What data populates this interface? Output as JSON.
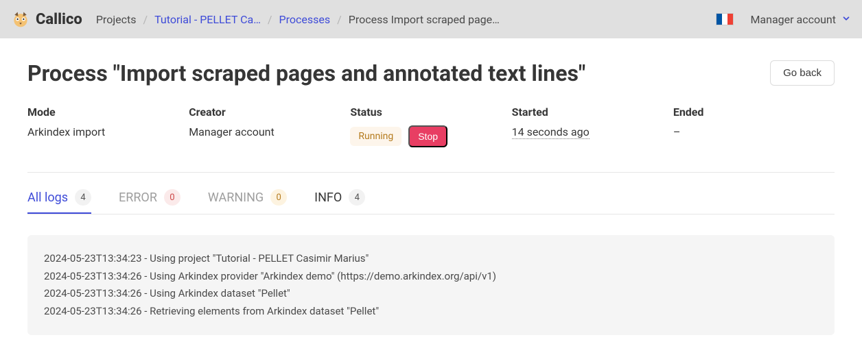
{
  "brand": "Callico",
  "breadcrumbs": {
    "projects": "Projects",
    "project": "Tutorial - PELLET Ca…",
    "processes": "Processes",
    "current": "Process Import scraped page…"
  },
  "nav": {
    "account": "Manager account"
  },
  "page": {
    "title": "Process \"Import scraped pages and annotated text lines\"",
    "go_back": "Go back"
  },
  "meta": {
    "mode_label": "Mode",
    "mode": "Arkindex import",
    "creator_label": "Creator",
    "creator": "Manager account",
    "status_label": "Status",
    "status_running": "Running",
    "status_stop": "Stop",
    "started_label": "Started",
    "started": "14 seconds ago",
    "ended_label": "Ended",
    "ended": "–"
  },
  "tabs": {
    "all": {
      "label": "All logs",
      "count": "4"
    },
    "error": {
      "label": "ERROR",
      "count": "0"
    },
    "warning": {
      "label": "WARNING",
      "count": "0"
    },
    "info": {
      "label": "INFO",
      "count": "4"
    }
  },
  "logs": "2024-05-23T13:34:23 - Using project \"Tutorial - PELLET Casimir Marius\"\n2024-05-23T13:34:26 - Using Arkindex provider \"Arkindex demo\" (https://demo.arkindex.org/api/v1)\n2024-05-23T13:34:26 - Using Arkindex dataset \"Pellet\"\n2024-05-23T13:34:26 - Retrieving elements from Arkindex dataset \"Pellet\""
}
